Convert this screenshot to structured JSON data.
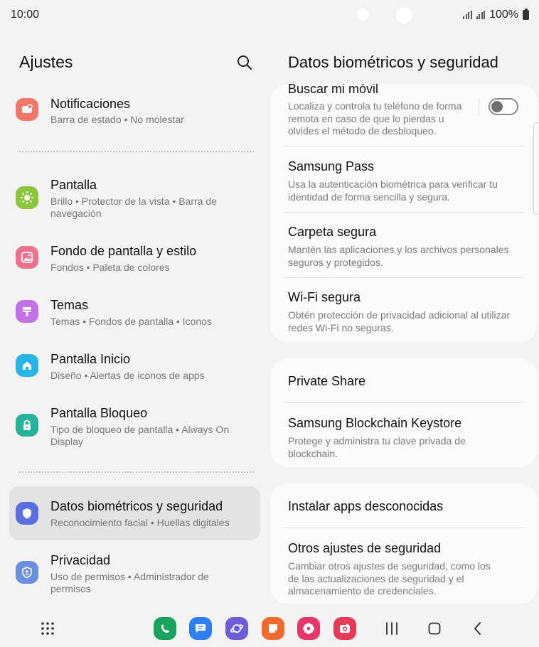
{
  "status": {
    "time": "10:00",
    "battery": "100%"
  },
  "left": {
    "title": "Ajustes",
    "items": [
      {
        "title": "Notificaciones",
        "sub": "Barra de estado  •  No molestar",
        "icon": "notifications-icon",
        "color": "#f2776b"
      },
      {
        "title": "Pantalla",
        "sub": "Brillo  •  Protector de la vista  •  Barra de navegación",
        "icon": "display-icon",
        "color": "#8cc63f"
      },
      {
        "title": "Fondo de pantalla y estilo",
        "sub": "Fondos  •  Paleta de colores",
        "icon": "wallpaper-icon",
        "color": "#ef6f8f"
      },
      {
        "title": "Temas",
        "sub": "Temas  •  Fondos de pantalla  •  Iconos",
        "icon": "themes-icon",
        "color": "#c270e6"
      },
      {
        "title": "Pantalla Inicio",
        "sub": "Diseño  •  Alertas de iconos de apps",
        "icon": "home-screen-icon",
        "color": "#27b5e8"
      },
      {
        "title": "Pantalla Bloqueo",
        "sub": "Tipo de bloqueo de pantalla  •  Always On Display",
        "icon": "lock-screen-icon",
        "color": "#27b39b"
      },
      {
        "title": "Datos biométricos y seguridad",
        "sub": "Reconocimiento facial  •  Huellas digitales",
        "icon": "security-shield-icon",
        "color": "#5a6ee0"
      },
      {
        "title": "Privacidad",
        "sub": "Uso de permisos  •  Administrador de permisos",
        "icon": "privacy-icon",
        "color": "#6b8fe0"
      }
    ]
  },
  "right": {
    "title": "Datos biométricos y seguridad",
    "card1": [
      {
        "title": "Buscar mi móvil",
        "sub": "Localiza y controla tu teléfono de forma remota en caso de que lo pierdas u olvides el método de desbloqueo."
      },
      {
        "title": "Samsung Pass",
        "sub": "Usa la autenticación biométrica para verificar tu identidad de forma sencilla y segura."
      },
      {
        "title": "Carpeta segura",
        "sub": "Mantén las aplicaciones y los archivos personales seguros y protegidos."
      },
      {
        "title": "Wi-Fi segura",
        "sub": "Obtén protección de privacidad adicional al utilizar redes Wi-Fi no seguras."
      }
    ],
    "card2": [
      {
        "title": "Private Share"
      },
      {
        "title": "Samsung Blockchain Keystore",
        "sub": "Protege y administra tu clave privada de blockchain."
      }
    ],
    "card3": [
      {
        "title": "Instalar apps desconocidas"
      },
      {
        "title": "Otros ajustes de seguridad",
        "sub": "Cambiar otros ajustes de seguridad, como los de las actualizaciones de seguridad y el almacenamiento de credenciales."
      }
    ],
    "find_my_mobile_toggle": "off"
  },
  "dock": {
    "apps": [
      {
        "icon": "phone-icon",
        "color": "#1aa35c"
      },
      {
        "icon": "messages-icon",
        "color": "#2f7ff0"
      },
      {
        "icon": "internet-icon",
        "color": "#6d5bd8"
      },
      {
        "icon": "notes-icon",
        "color": "#f06a2b"
      },
      {
        "icon": "gallery-icon",
        "color": "#e8356a"
      },
      {
        "icon": "camera-icon",
        "color": "#e63a5a"
      }
    ]
  }
}
